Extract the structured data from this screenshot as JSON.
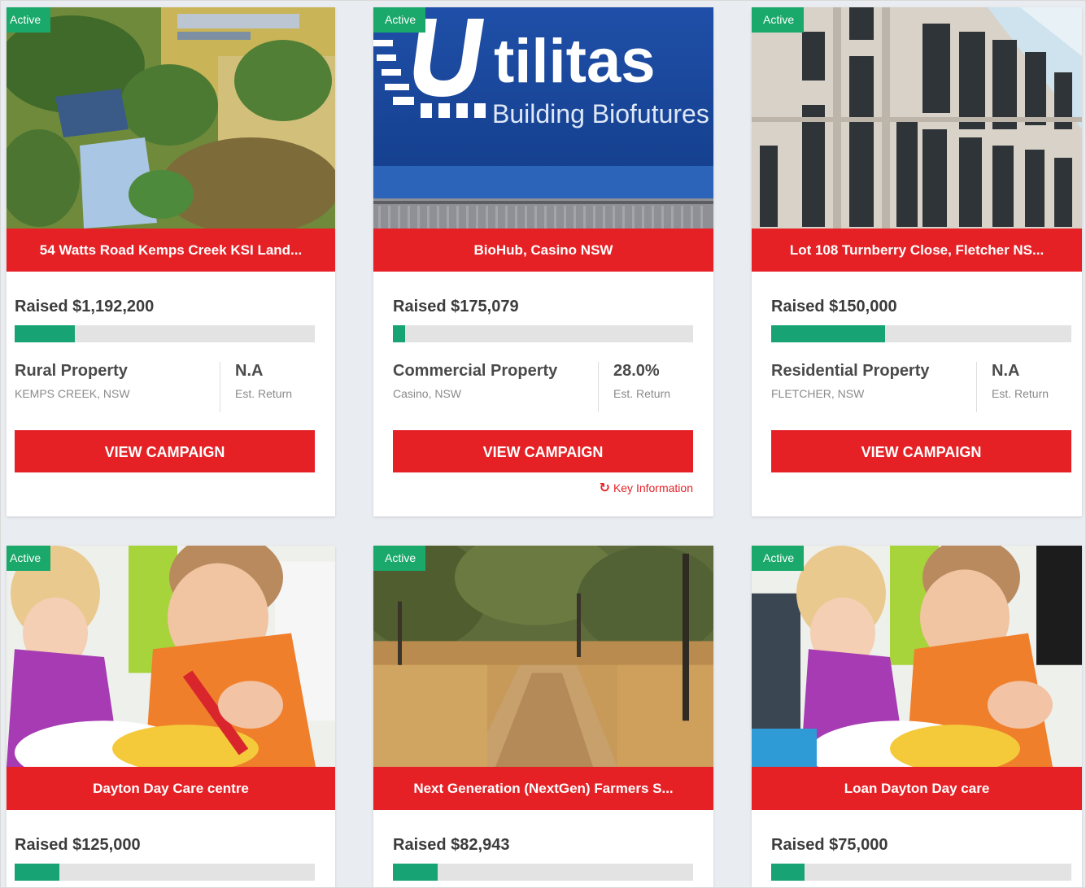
{
  "cards": [
    {
      "status": "Active",
      "title": "54 Watts Road Kemps Creek KSI Land...",
      "raised": "Raised $1,192,200",
      "progress_fraction": 0.2,
      "property_type": "Rural Property",
      "location": "KEMPS CREEK, NSW",
      "return_value": "N.A",
      "return_label": "Est. Return",
      "button_label": "VIEW CAMPAIGN"
    },
    {
      "status": "Active",
      "title": "BioHub, Casino NSW",
      "image_text": {
        "brand": "tilitas",
        "tagline": "Building Biofutures"
      },
      "raised": "Raised $175,079",
      "progress_fraction": 0.04,
      "property_type": "Commercial Property",
      "location": "Casino, NSW",
      "return_value": "28.0%",
      "return_label": "Est. Return",
      "button_label": "VIEW CAMPAIGN",
      "key_info_label": "Key Information"
    },
    {
      "status": "Active",
      "title": "Lot 108 Turnberry Close, Fletcher NS...",
      "raised": "Raised $150,000",
      "progress_fraction": 0.38,
      "property_type": "Residential Property",
      "location": "FLETCHER, NSW",
      "return_value": "N.A",
      "return_label": "Est. Return",
      "button_label": "VIEW CAMPAIGN"
    },
    {
      "status": "Active",
      "title": "Dayton Day Care centre",
      "raised": "Raised $125,000",
      "progress_fraction": 0.15
    },
    {
      "status": "Active",
      "title": "Next Generation (NextGen) Farmers S...",
      "raised": "Raised $82,943",
      "progress_fraction": 0.15
    },
    {
      "status": "Active",
      "title": "Loan Dayton Day care",
      "raised": "Raised $75,000",
      "progress_fraction": 0.11
    }
  ],
  "colors": {
    "brand_red": "#e52126",
    "active_green": "#1aa86b",
    "progress_green": "#18a374",
    "progress_track": "#e3e3e3"
  },
  "icons": {
    "key_info": "refresh-icon"
  }
}
